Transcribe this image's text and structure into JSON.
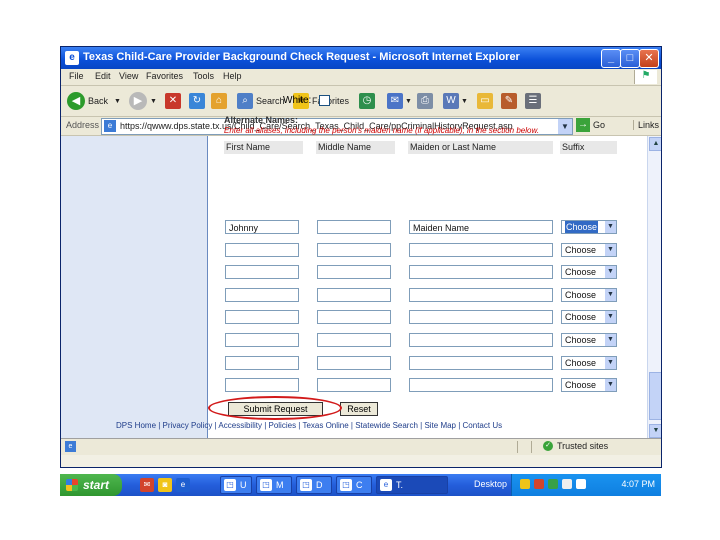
{
  "window": {
    "title": "Texas Child-Care Provider Background Check Request - Microsoft Internet Explorer",
    "controls": {
      "min": "_",
      "max": "□",
      "close": "✕"
    }
  },
  "menu": [
    "File",
    "Edit",
    "View",
    "Favorites",
    "Tools",
    "Help"
  ],
  "toolbar": {
    "back": "Back",
    "search": "Search",
    "favorites": "Favorites"
  },
  "address": {
    "label": "Address",
    "url": "https://qwww.dps.state.tx.us/Child_Care/Search_Texas_Child_Care/ppCriminalHistoryRequest.asp",
    "go": "Go",
    "links": "Links"
  },
  "form": {
    "white_label": "White:",
    "alt_title": "Alternate Names:",
    "instruction": "Enter all aliases, including the person's maiden name (if applicable), in the section below.",
    "columns": [
      "First Name",
      "Middle Name",
      "Maiden or Last Name",
      "Suffix"
    ],
    "rows": [
      {
        "first": "Johnny",
        "middle": "",
        "last": "Maiden Name",
        "suffix": "Choose"
      },
      {
        "first": "",
        "middle": "",
        "last": "",
        "suffix": "Choose"
      },
      {
        "first": "",
        "middle": "",
        "last": "",
        "suffix": "Choose"
      },
      {
        "first": "",
        "middle": "",
        "last": "",
        "suffix": "Choose"
      },
      {
        "first": "",
        "middle": "",
        "last": "",
        "suffix": "Choose"
      },
      {
        "first": "",
        "middle": "",
        "last": "",
        "suffix": "Choose"
      },
      {
        "first": "",
        "middle": "",
        "last": "",
        "suffix": "Choose"
      },
      {
        "first": "",
        "middle": "",
        "last": "",
        "suffix": "Choose"
      }
    ],
    "submit": "Submit Request",
    "reset": "Reset"
  },
  "footer": "DPS Home | Privacy Policy | Accessibility | Policies | Texas Online | Statewide Search | Site Map | Contact Us",
  "status": {
    "zone": "Trusted sites"
  },
  "taskbar": {
    "start": "start",
    "tasks": [
      "U",
      "M",
      "D",
      "C",
      "T."
    ],
    "desktop": "Desktop",
    "clock": "4:07 PM"
  },
  "colors": {
    "title_blue": "#0a4fd8",
    "instruction_red": "#cc0000",
    "highlight": "#d21a1a",
    "taskbar": "#245edb"
  }
}
